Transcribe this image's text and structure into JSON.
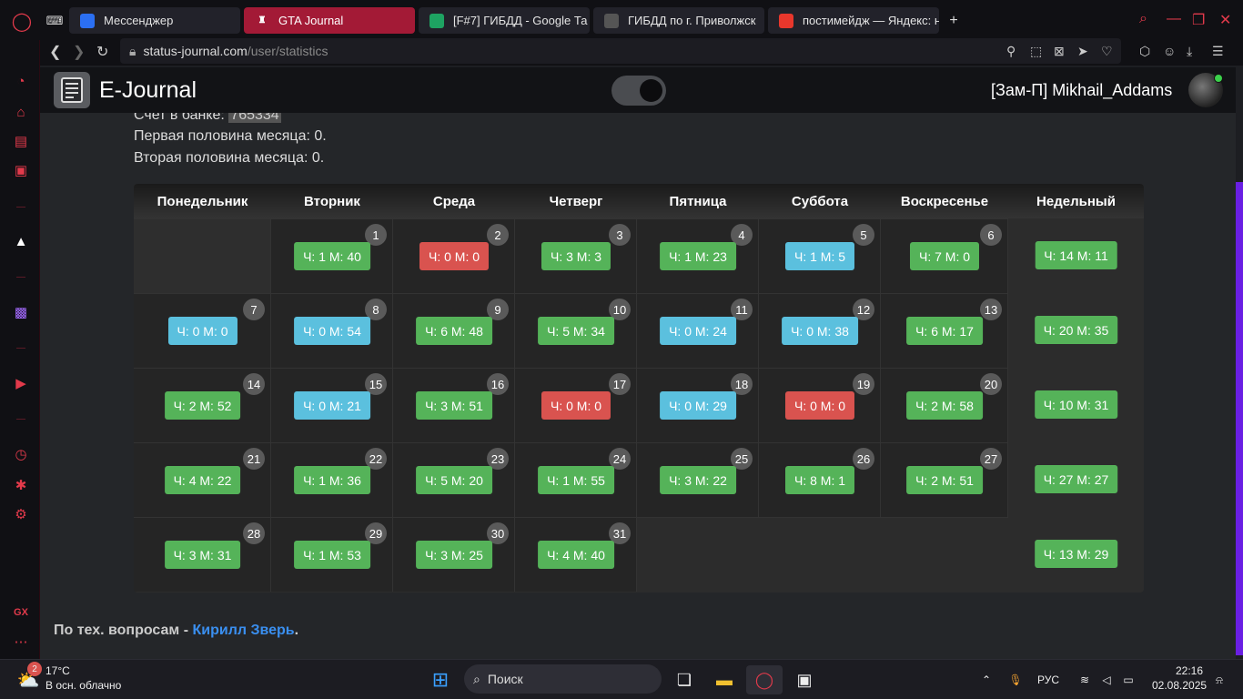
{
  "browser": {
    "tabs": [
      {
        "label": "Мессенджер",
        "icon": "play-icon",
        "color": "#2b6ff2"
      },
      {
        "label": "GTA Journal",
        "icon": "journal-icon",
        "color": "#a31a36",
        "active": true
      },
      {
        "label": "[F#7] ГИБДД - Google Та",
        "icon": "sheets-icon",
        "color": "#1ea362"
      },
      {
        "label": "ГИБДД по г. Приволжск",
        "icon": "car-icon",
        "color": "#555"
      },
      {
        "label": "постимейдж — Яндекс: н",
        "icon": "yandex-icon",
        "color": "#e8372c"
      }
    ],
    "url_host": "status-journal.com",
    "url_path": "/user/statistics"
  },
  "app": {
    "title": "E-Journal",
    "user": "[Зам-П] Mikhail_Addams",
    "bank_label": "Счет в банке:",
    "bank_value": "765334",
    "first_half": "Первая половина месяца: 0.",
    "second_half": "Вторая половина месяца: 0.",
    "footer_prefix": "По тех. вопросам - ",
    "footer_link": "Кирилл Зверь",
    "footer_suffix": "."
  },
  "calendar": {
    "headers": [
      "Понедельник",
      "Вторник",
      "Среда",
      "Четверг",
      "Пятница",
      "Суббота",
      "Воскресенье",
      "Недельный"
    ],
    "weeks": [
      {
        "days": [
          null,
          {
            "n": "1",
            "t": "Ч: 1 М: 40",
            "c": "g"
          },
          {
            "n": "2",
            "t": "Ч: 0 М: 0",
            "c": "r"
          },
          {
            "n": "3",
            "t": "Ч: 3 М: 3",
            "c": "g"
          },
          {
            "n": "4",
            "t": "Ч: 1 М: 23",
            "c": "g"
          },
          {
            "n": "5",
            "t": "Ч: 1 М: 5",
            "c": "b"
          },
          {
            "n": "6",
            "t": "Ч: 7 М: 0",
            "c": "g"
          }
        ],
        "total": "Ч: 14 М: 11"
      },
      {
        "days": [
          {
            "n": "7",
            "t": "Ч: 0 М: 0",
            "c": "b"
          },
          {
            "n": "8",
            "t": "Ч: 0 М: 54",
            "c": "b"
          },
          {
            "n": "9",
            "t": "Ч: 6 М: 48",
            "c": "g"
          },
          {
            "n": "10",
            "t": "Ч: 5 М: 34",
            "c": "g"
          },
          {
            "n": "11",
            "t": "Ч: 0 М: 24",
            "c": "b"
          },
          {
            "n": "12",
            "t": "Ч: 0 М: 38",
            "c": "b"
          },
          {
            "n": "13",
            "t": "Ч: 6 М: 17",
            "c": "g"
          }
        ],
        "total": "Ч: 20 М: 35"
      },
      {
        "days": [
          {
            "n": "14",
            "t": "Ч: 2 М: 52",
            "c": "g"
          },
          {
            "n": "15",
            "t": "Ч: 0 М: 21",
            "c": "b"
          },
          {
            "n": "16",
            "t": "Ч: 3 М: 51",
            "c": "g"
          },
          {
            "n": "17",
            "t": "Ч: 0 М: 0",
            "c": "r"
          },
          {
            "n": "18",
            "t": "Ч: 0 М: 29",
            "c": "b"
          },
          {
            "n": "19",
            "t": "Ч: 0 М: 0",
            "c": "r"
          },
          {
            "n": "20",
            "t": "Ч: 2 М: 58",
            "c": "g"
          }
        ],
        "total": "Ч: 10 М: 31"
      },
      {
        "days": [
          {
            "n": "21",
            "t": "Ч: 4 М: 22",
            "c": "g"
          },
          {
            "n": "22",
            "t": "Ч: 1 М: 36",
            "c": "g"
          },
          {
            "n": "23",
            "t": "Ч: 5 М: 20",
            "c": "g"
          },
          {
            "n": "24",
            "t": "Ч: 1 М: 55",
            "c": "g"
          },
          {
            "n": "25",
            "t": "Ч: 3 М: 22",
            "c": "g"
          },
          {
            "n": "26",
            "t": "Ч: 8 М: 1",
            "c": "g"
          },
          {
            "n": "27",
            "t": "Ч: 2 М: 51",
            "c": "g"
          }
        ],
        "total": "Ч: 27 М: 27"
      },
      {
        "days": [
          {
            "n": "28",
            "t": "Ч: 3 М: 31",
            "c": "g"
          },
          {
            "n": "29",
            "t": "Ч: 1 М: 53",
            "c": "g"
          },
          {
            "n": "30",
            "t": "Ч: 3 М: 25",
            "c": "g"
          },
          {
            "n": "31",
            "t": "Ч: 4 М: 40",
            "c": "g"
          },
          null,
          null,
          null
        ],
        "total": "Ч: 13 М: 29"
      }
    ]
  },
  "taskbar": {
    "weather_temp": "17°C",
    "weather_desc": "В осн. облачно",
    "weather_badge": "2",
    "search": "Поиск",
    "lang": "РУС",
    "time": "22:16",
    "date": "02.08.2025"
  }
}
